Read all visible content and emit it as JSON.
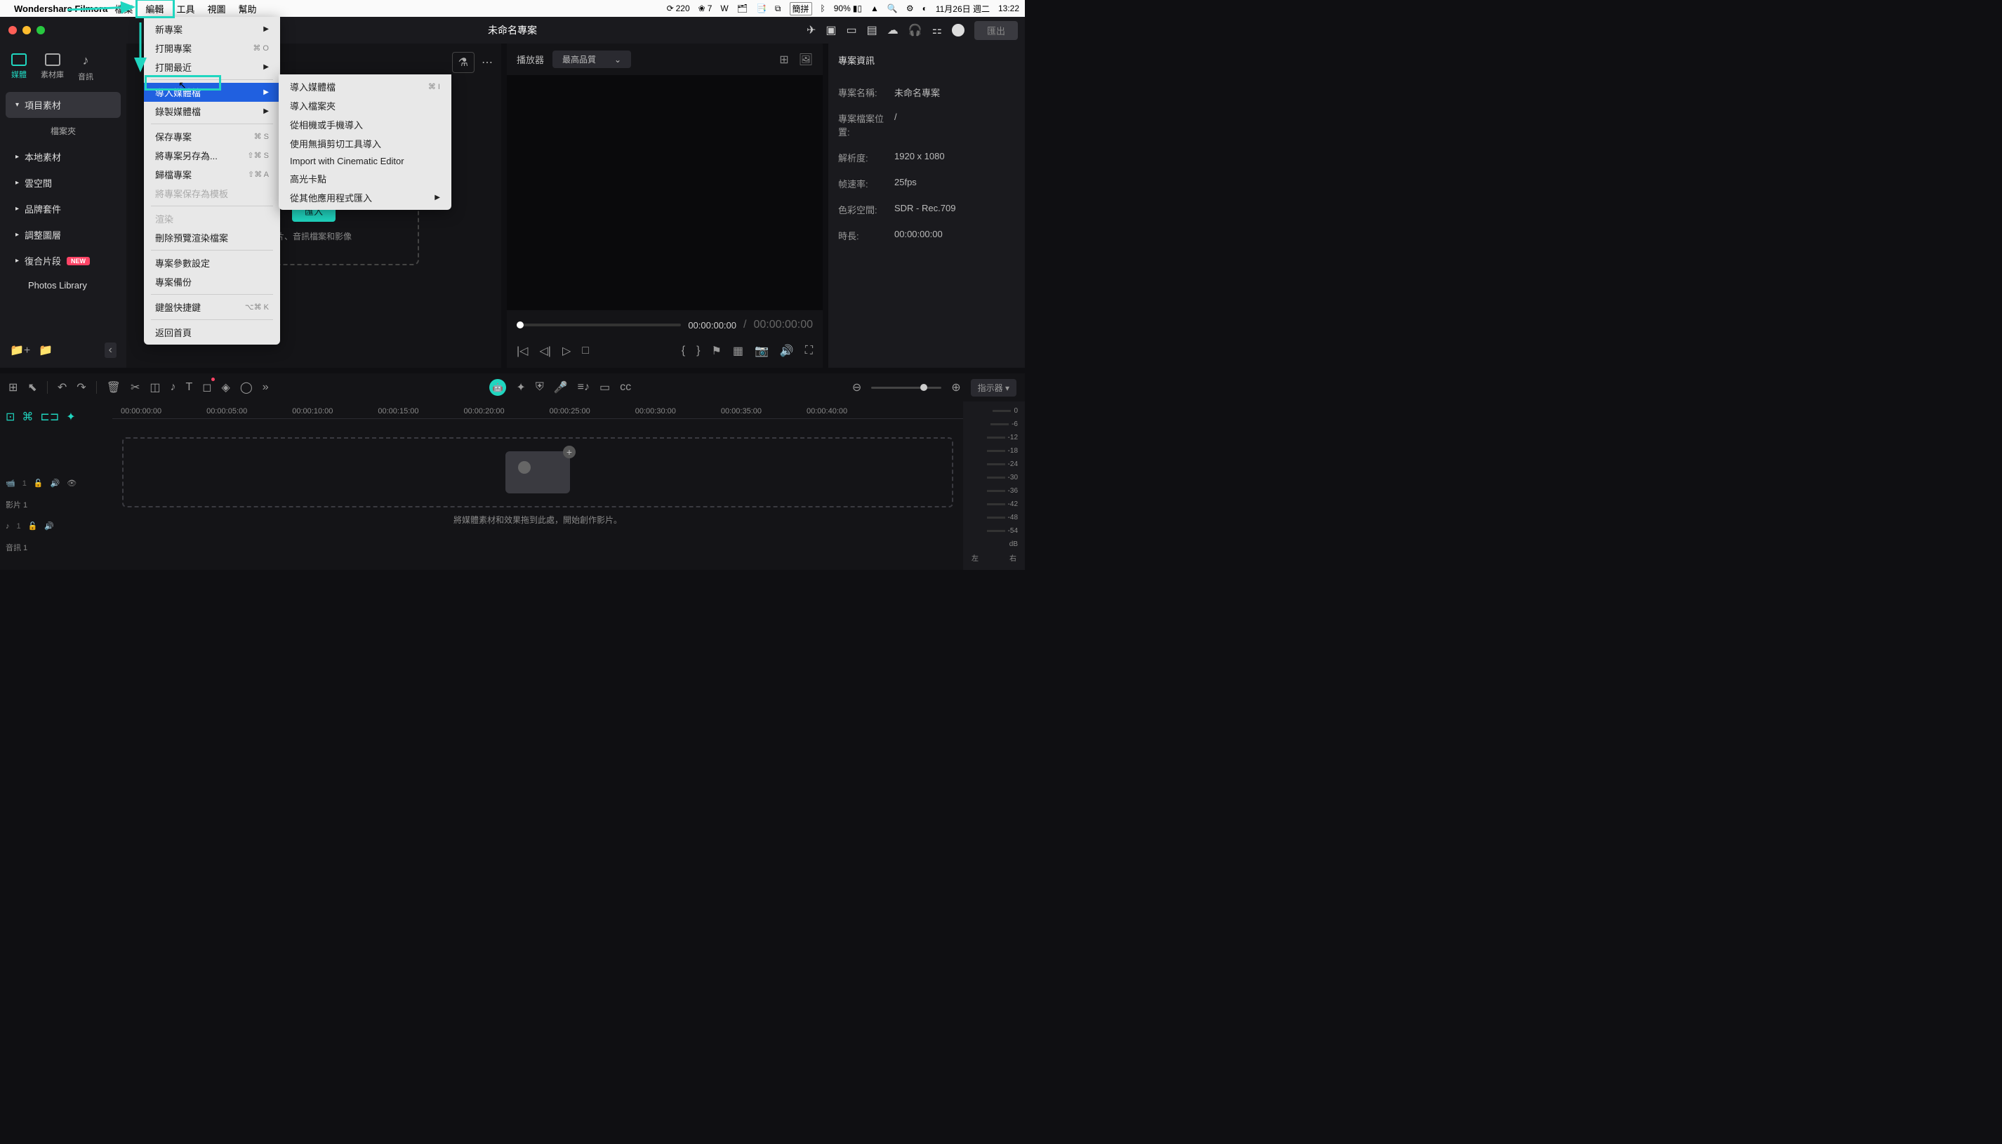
{
  "mac_menu": {
    "app_name": "Wondershare Filmora",
    "items": [
      "檔案",
      "編輯",
      "工具",
      "視圖",
      "幫助"
    ],
    "right": {
      "counter1": "220",
      "counter2": "7",
      "input_method": "簡拼",
      "battery": "90%",
      "date": "11月26日 週二",
      "time": "13:22"
    }
  },
  "window": {
    "title": "未命名專案",
    "export_label": "匯出"
  },
  "nav_tabs": [
    {
      "label": "媒體",
      "active": true
    },
    {
      "label": "素材庫",
      "active": false
    },
    {
      "label": "音訊",
      "active": false
    }
  ],
  "sidebar": {
    "items": [
      {
        "label": "項目素材",
        "selected": true,
        "expandable": true
      },
      {
        "label": "檔案夾",
        "header": true
      },
      {
        "label": "本地素材",
        "expandable": true
      },
      {
        "label": "雲空間",
        "expandable": true
      },
      {
        "label": "品牌套件",
        "expandable": true
      },
      {
        "label": "調整圖層",
        "expandable": true
      },
      {
        "label": "復合片段",
        "expandable": true,
        "badge": "NEW"
      },
      {
        "label": "Photos Library"
      }
    ]
  },
  "import_area": {
    "button": "匯入",
    "hint": "、音訊檔案和影像",
    "partial_hint_prefix": "片"
  },
  "player": {
    "label": "播放器",
    "quality": "最高品質",
    "time_current": "00:00:00:00",
    "time_separator": "/",
    "time_total": "00:00:00:00"
  },
  "info_panel": {
    "title": "專案資訊",
    "rows": [
      {
        "label": "專案名稱:",
        "value": "未命名專案"
      },
      {
        "label": "專案檔案位置:",
        "value": "/"
      },
      {
        "label": "解析度:",
        "value": "1920 x 1080"
      },
      {
        "label": "帧速率:",
        "value": "25fps"
      },
      {
        "label": "色彩空間:",
        "value": "SDR - Rec.709"
      },
      {
        "label": "時長:",
        "value": "00:00:00:00"
      }
    ]
  },
  "toolbar": {
    "indicator": "指示器"
  },
  "timeline": {
    "ruler": [
      "00:00:00:00",
      "00:00:05:00",
      "00:00:10:00",
      "00:00:15:00",
      "00:00:20:00",
      "00:00:25:00",
      "00:00:30:00",
      "00:00:35:00",
      "00:00:40:00"
    ],
    "tracks": [
      {
        "name": "影片 1",
        "icons": [
          "camera",
          "lock",
          "speaker",
          "eye"
        ]
      },
      {
        "name": "音訊 1",
        "icons": [
          "music",
          "lock",
          "speaker"
        ]
      }
    ],
    "drop_hint": "將媒體素材和效果拖到此處，開始創作影片。"
  },
  "audio_meter": {
    "scale": [
      "0",
      "-6",
      "-12",
      "-18",
      "-24",
      "-30",
      "-36",
      "-42",
      "-48",
      "-54",
      "dB"
    ],
    "bottom": [
      "左",
      "右"
    ]
  },
  "dropdown1": [
    {
      "label": "新專案",
      "submenu": true
    },
    {
      "label": "打開專案",
      "kbd": "⌘ O"
    },
    {
      "label": "打開最近",
      "submenu": true
    },
    {
      "sep": true
    },
    {
      "label": "導入媒體檔",
      "submenu": true,
      "highlighted": true
    },
    {
      "label": "錄製媒體檔",
      "submenu": true
    },
    {
      "sep": true
    },
    {
      "label": "保存專案",
      "kbd": "⌘ S"
    },
    {
      "label": "將專案另存為...",
      "kbd": "⇧⌘ S"
    },
    {
      "label": "歸檔專案",
      "kbd": "⇧⌘ A"
    },
    {
      "label": "將專案保存為模板",
      "disabled": true
    },
    {
      "sep": true
    },
    {
      "label": "渲染",
      "disabled": true
    },
    {
      "label": "刪除預覽渲染檔案"
    },
    {
      "sep": true
    },
    {
      "label": "專案參數設定"
    },
    {
      "label": "專案備份"
    },
    {
      "sep": true
    },
    {
      "label": "鍵盤快捷鍵",
      "kbd": "⌥⌘ K"
    },
    {
      "sep": true
    },
    {
      "label": "返回首頁"
    }
  ],
  "dropdown2": [
    {
      "label": "導入媒體檔",
      "kbd": "⌘ I"
    },
    {
      "label": "導入檔案夾"
    },
    {
      "label": "從相機或手機導入"
    },
    {
      "label": "使用無損剪切工具導入"
    },
    {
      "label": "Import with Cinematic Editor"
    },
    {
      "label": "高光卡點"
    },
    {
      "label": "從其他應用程式匯入",
      "submenu": true
    }
  ]
}
